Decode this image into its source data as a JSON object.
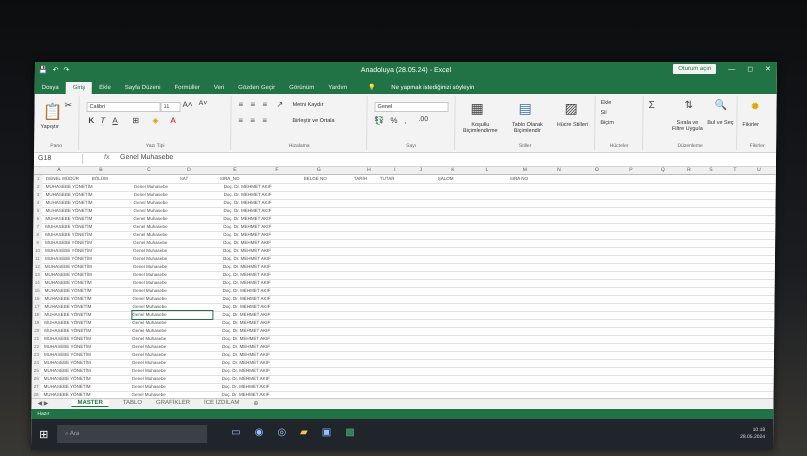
{
  "window": {
    "title": "Anadoluya (28.05.24) - Excel",
    "sign_in": "Oturum açın",
    "minimize": "—",
    "maximize": "◻",
    "close": "✕"
  },
  "quickaccess": {
    "save": "💾",
    "undo": "↶",
    "redo": "↷"
  },
  "menu": {
    "items": [
      "Dosya",
      "Giriş",
      "Ekle",
      "Sayfa Düzeni",
      "Formüller",
      "Veri",
      "Gözden Geçir",
      "Görünüm",
      "Yardım"
    ],
    "tell": "Ne yapmak istediğinizi söyleyin"
  },
  "ribbon": {
    "paste": "Yapıştır",
    "clipboard": "Pano",
    "font_name": "Calibri",
    "font_size": "11",
    "font_group": "Yazı Tipi",
    "wrap_text": "Metni Kaydır",
    "merge": "Birleştir ve Ortala",
    "align_group": "Hizalama",
    "number_format": "Genel",
    "number_group": "Sayı",
    "cond_format": "Koşullu Biçimlendirme",
    "as_table": "Tablo Olarak Biçimlendir",
    "cell_styles": "Hücre Stilleri",
    "styles_group": "Stiller",
    "insert": "Ekle",
    "delete": "Sil",
    "format": "Biçim",
    "cells_group": "Hücreler",
    "sort_filter": "Sırala ve Filtre Uygula",
    "find": "Bul ve Seç",
    "editing_group": "Düzenleme",
    "ideas": "Fikirler",
    "ideas_group": "Fikirler"
  },
  "formula": {
    "namebox": "G18",
    "fx": "fx",
    "value": "Genel Muhasebe"
  },
  "columns": [
    "A",
    "B",
    "C",
    "D",
    "E",
    "F",
    "G",
    "H",
    "I",
    "J",
    "K",
    "L",
    "M",
    "N",
    "O",
    "P",
    "Q",
    "R",
    "S",
    "T",
    "U"
  ],
  "header_row": [
    "GENEL MÜDÜR",
    "BÖLÜM",
    "SAT",
    "SIRA_NO",
    "",
    "BELGE NO",
    "",
    "TARİH",
    "TUTAR",
    "ŞALOM",
    "SIRA NO"
  ],
  "rows_label": "MUHASEBE YÖNETİM",
  "dept_label": "Genel Muhasebe",
  "person_label": "Doç. Dr. MEHMET AKIF",
  "sheet_tabs": [
    "MASTER",
    "TABLO",
    "GRAFİKLER",
    "İCE İZDİLAM"
  ],
  "status": "Hazır",
  "taskbar": {
    "search": "Ara",
    "time": "10:18",
    "date": "28.05.2024"
  }
}
